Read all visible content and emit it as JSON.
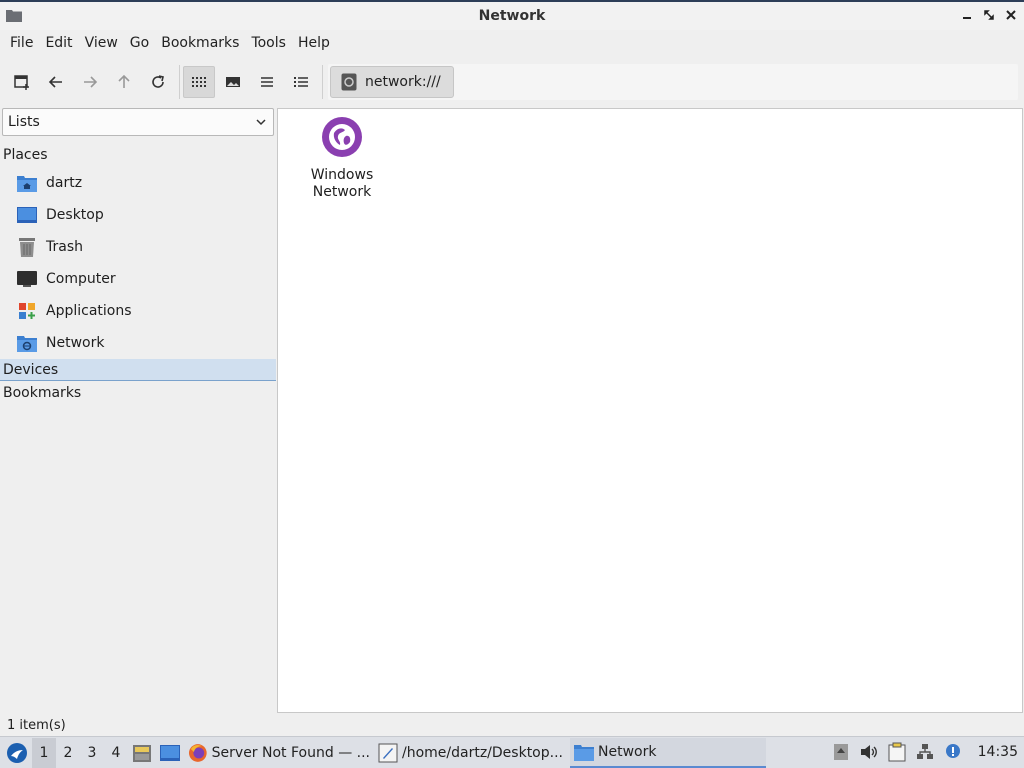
{
  "window": {
    "title": "Network"
  },
  "menu": [
    "File",
    "Edit",
    "View",
    "Go",
    "Bookmarks",
    "Tools",
    "Help"
  ],
  "path": {
    "location": "network:///"
  },
  "sidebar": {
    "mode": "Lists",
    "places_header": "Places",
    "places": [
      {
        "label": "dartz",
        "icon": "home-folder-icon"
      },
      {
        "label": "Desktop",
        "icon": "desktop-icon"
      },
      {
        "label": "Trash",
        "icon": "trash-icon"
      },
      {
        "label": "Computer",
        "icon": "computer-icon"
      },
      {
        "label": "Applications",
        "icon": "applications-icon"
      },
      {
        "label": "Network",
        "icon": "network-folder-icon"
      }
    ],
    "devices_header": "Devices",
    "bookmarks_header": "Bookmarks"
  },
  "main": {
    "items": [
      {
        "label_line1": "Windows",
        "label_line2": "Network",
        "icon": "globe-icon"
      }
    ]
  },
  "status": {
    "text": "1 item(s)"
  },
  "taskbar": {
    "workspaces": [
      "1",
      "2",
      "3",
      "4"
    ],
    "tasks": [
      {
        "label": "Server Not Found — ..."
      },
      {
        "label": "/home/dartz/Desktop..."
      },
      {
        "label": "Network"
      }
    ],
    "clock": "14:35"
  },
  "colors": {
    "accent": "#5b8ad0",
    "globe": "#8a3fb0",
    "selection": "#d0dfef"
  }
}
